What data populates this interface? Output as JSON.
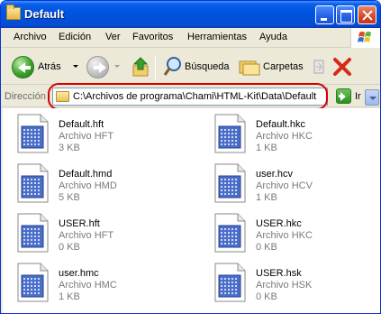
{
  "window": {
    "title": "Default"
  },
  "menu": [
    "Archivo",
    "Edición",
    "Ver",
    "Favoritos",
    "Herramientas",
    "Ayuda"
  ],
  "toolbar": {
    "back_label": "Atrás",
    "search_label": "Búsqueda",
    "folders_label": "Carpetas"
  },
  "address": {
    "label": "Dirección",
    "value": "C:\\Archivos de programa\\Chami\\HTML-Kit\\Data\\Default",
    "go_label": "Ir"
  },
  "files": [
    {
      "name": "Default.hft",
      "type": "Archivo HFT",
      "size": "3 KB"
    },
    {
      "name": "Default.hkc",
      "type": "Archivo HKC",
      "size": "1 KB"
    },
    {
      "name": "Default.hmd",
      "type": "Archivo HMD",
      "size": "5 KB"
    },
    {
      "name": "user.hcv",
      "type": "Archivo HCV",
      "size": "1 KB"
    },
    {
      "name": "USER.hft",
      "type": "Archivo HFT",
      "size": "0 KB"
    },
    {
      "name": "USER.hkc",
      "type": "Archivo HKC",
      "size": "0 KB"
    },
    {
      "name": "user.hmc",
      "type": "Archivo HMC",
      "size": "1 KB"
    },
    {
      "name": "USER.hsk",
      "type": "Archivo HSK",
      "size": "0 KB"
    }
  ],
  "colors": {
    "titlebar": "#0054e3",
    "highlight": "#d40000",
    "subtext": "#7a7a7a"
  }
}
